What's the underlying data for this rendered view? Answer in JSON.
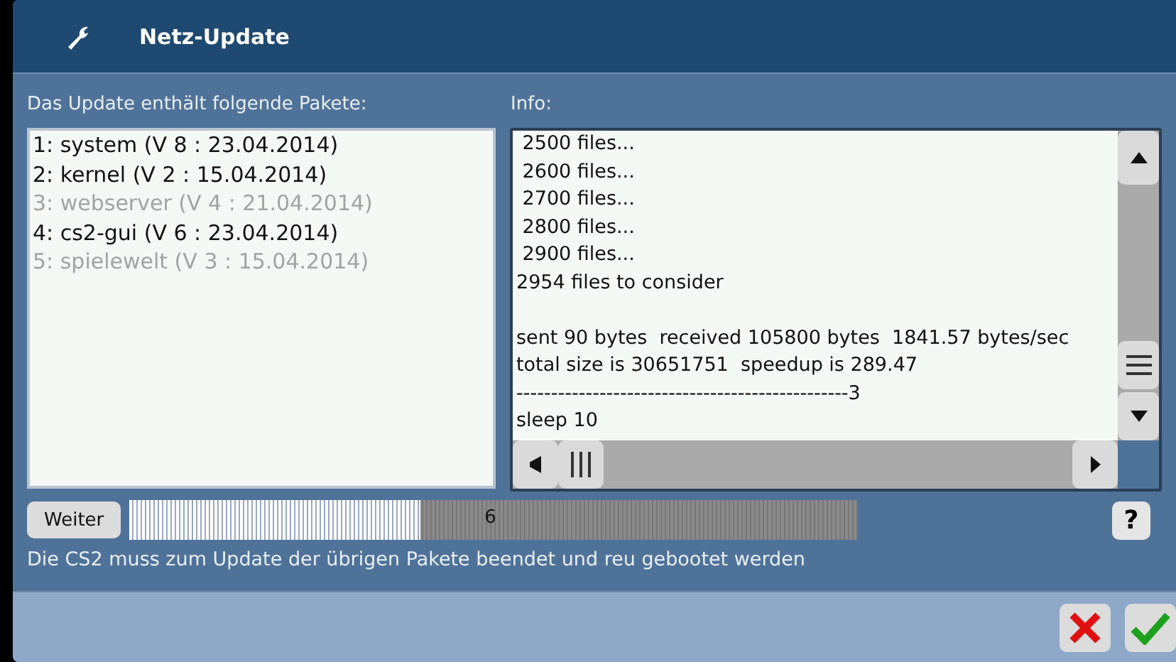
{
  "window": {
    "title": "Netz-Update"
  },
  "packages": {
    "label": "Das Update enthält folgende Pakete:",
    "items": [
      {
        "text": "1: system (V 8 : 23.04.2014)",
        "disabled": false
      },
      {
        "text": "2: kernel (V 2 : 15.04.2014)",
        "disabled": false
      },
      {
        "text": "3: webserver (V 4 : 21.04.2014)",
        "disabled": true
      },
      {
        "text": "4: cs2-gui (V 6 : 23.04.2014)",
        "disabled": false
      },
      {
        "text": "5: spielewelt (V 3 : 15.04.2014)",
        "disabled": true
      }
    ]
  },
  "info": {
    "label": "Info:",
    "lines": [
      {
        "text": " 2500 files...",
        "blank_before": false
      },
      {
        "text": " 2600 files...",
        "blank_before": false
      },
      {
        "text": " 2700 files...",
        "blank_before": false
      },
      {
        "text": " 2800 files...",
        "blank_before": false
      },
      {
        "text": " 2900 files...",
        "blank_before": false
      },
      {
        "text": "2954 files to consider",
        "blank_before": false
      },
      {
        "text": "sent 90 bytes  received 105800 bytes  1841.57 bytes/sec",
        "blank_before": true
      },
      {
        "text": "total size is 30651751  speedup is 289.47",
        "blank_before": false
      },
      {
        "text": "------------------------------------------------3",
        "blank_before": false
      },
      {
        "text": "sleep 10",
        "blank_before": false
      }
    ]
  },
  "next_button": "Weiter",
  "progress": {
    "level": 0.4,
    "reading": "6"
  },
  "help_button": "?",
  "message": "Die CS2 muss zum Update der übrigen Pakete beendet und reu gebootet werden"
}
